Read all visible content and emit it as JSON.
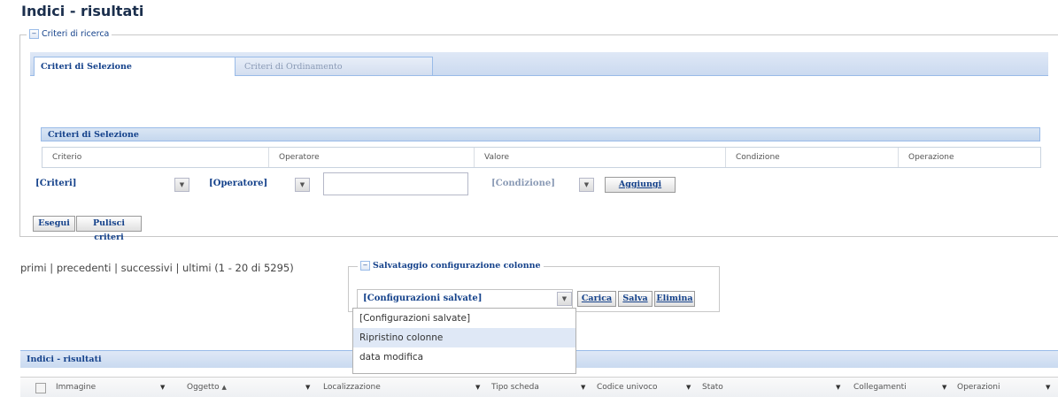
{
  "page": {
    "title": "Indici - risultati"
  },
  "search_criteria": {
    "legend": "Criteri di ricerca",
    "tabs": [
      {
        "label": "Criteri di Selezione"
      },
      {
        "label": "Criteri di Ordinamento"
      }
    ],
    "panel_title": "Criteri di Selezione",
    "columns": [
      "Criterio",
      "Operatore",
      "Valore",
      "Condizione",
      "Operazione"
    ],
    "criteria_select": "[Criteri]",
    "operator_select": "[Operatore]",
    "value_input": "",
    "condition_select": "[Condizione]",
    "add_button": "Aggiungi",
    "execute_button": "Esegui",
    "clear_button": "Pulisci criteri"
  },
  "pager": {
    "first": "primi",
    "prev": "precedenti",
    "next": "successivi",
    "last": "ultimi",
    "sep": "|",
    "range": "(1 - 20 di 5295)"
  },
  "column_config": {
    "legend": "Salvataggio configurazione colonne",
    "select_value": "[Configurazioni salvate]",
    "load_button": "Carica",
    "save_button": "Salva",
    "delete_button": "Elimina",
    "options": [
      "[Configurazioni salvate]",
      "Ripristino colonne",
      "data modifica"
    ],
    "highlighted_option": "Ripristino colonne"
  },
  "results": {
    "title": "Indici - risultati",
    "columns": [
      "Immagine",
      "Oggetto",
      "Localizzazione",
      "Tipo scheda",
      "Codice univoco",
      "Stato",
      "Collegamenti",
      "Operazioni"
    ],
    "sorted_column_marker": "▲"
  },
  "icons": {
    "collapse": "collapse-minus-icon",
    "dropdown_arrow": "chevron-down-icon"
  },
  "colors": {
    "accent": "#15428b",
    "header_bg": "#dfe8f6",
    "highlight": "#dfe8f6"
  }
}
